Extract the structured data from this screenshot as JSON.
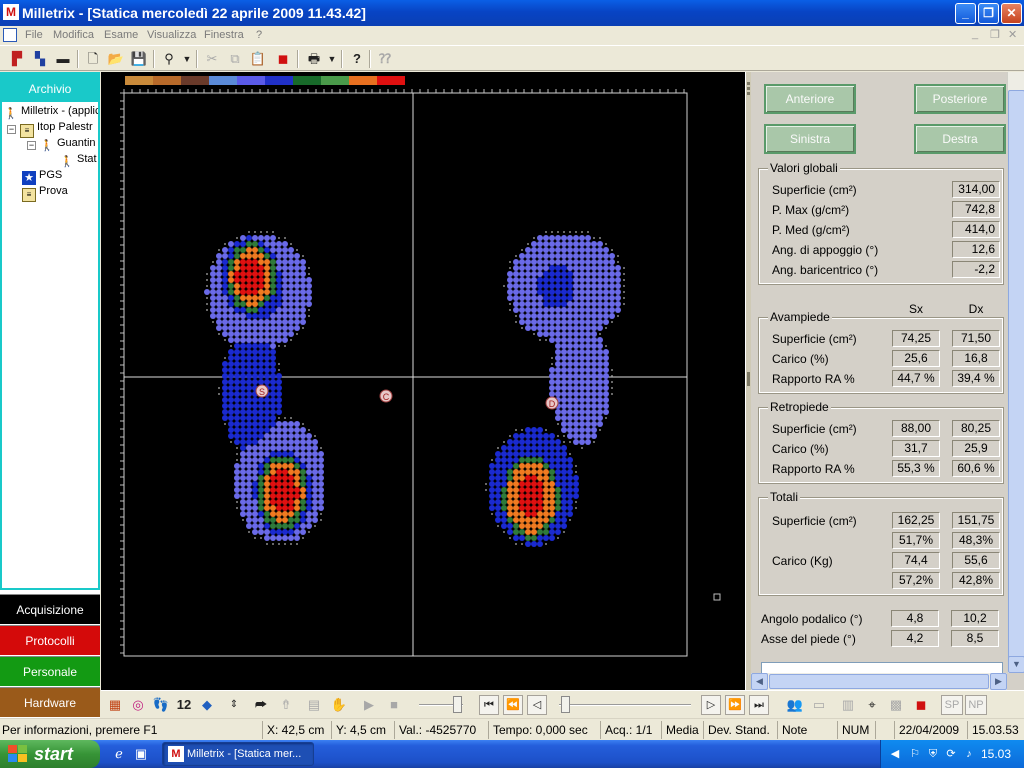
{
  "window": {
    "title": "Milletrix - [Statica mercoledì 22 aprile 2009 11.43.42]",
    "app_icon": "milletrix-logo"
  },
  "menu": {
    "items": [
      "File",
      "Modifica",
      "Esame",
      "Visualizza",
      "Finestra",
      "?"
    ]
  },
  "toolbar": {
    "icons": [
      "layout-icon",
      "split-layout-icon",
      "black-rect-icon",
      "new-file-icon",
      "open-folder-icon",
      "save-icon",
      "tools-icon",
      "cut-icon",
      "copy-icon",
      "paste-icon",
      "color-select-icon",
      "print-icon",
      "help-icon",
      "context-help-icon"
    ]
  },
  "left_panel": {
    "header": "Archivio",
    "tree": [
      {
        "label": "Milletrix - (applic",
        "icon": "person-icon"
      },
      {
        "label": "Itop Palestr",
        "icon": "folder-icon"
      },
      {
        "label": "Guantin",
        "icon": "person-icon"
      },
      {
        "label": "Stat",
        "icon": "person-icon"
      },
      {
        "label": "PGS",
        "icon": "pgs-icon"
      },
      {
        "label": "Prova",
        "icon": "folder-icon"
      }
    ],
    "nav": [
      {
        "label": "Acquisizione",
        "color": "#000000"
      },
      {
        "label": "Protocolli",
        "color": "#d40a0a"
      },
      {
        "label": "Personale",
        "color": "#139a13"
      },
      {
        "label": "Hardware",
        "color": "#9a5a1a"
      }
    ]
  },
  "canvas": {
    "colorbar": [
      "#c98a3a",
      "#b86a2a",
      "#6a3a2a",
      "#5a8ad8",
      "#5a5ae8",
      "#2030c8",
      "#186a2a",
      "#4a9a4a",
      "#e87020",
      "#e01010"
    ],
    "markers": {
      "s_label": "S",
      "c_label": "C",
      "d_label": "D"
    }
  },
  "right_panel": {
    "buttons": {
      "anteriore": "Anteriore",
      "posteriore": "Posteriore",
      "sinistra": "Sinistra",
      "destra": "Destra"
    },
    "valori_globali": {
      "title": "Valori globali",
      "rows": [
        {
          "label": "Superficie (cm²)",
          "value": "314,00"
        },
        {
          "label": "P. Max (g/cm²)",
          "value": "742,8"
        },
        {
          "label": "P. Med (g/cm²)",
          "value": "414,0"
        },
        {
          "label": "Ang. di appoggio (°)",
          "value": "12,6"
        },
        {
          "label": "Ang. baricentrico (°)",
          "value": "-2,2"
        }
      ]
    },
    "col_sx": "Sx",
    "col_dx": "Dx",
    "avampiede": {
      "title": "Avampiede",
      "rows": [
        {
          "label": "Superficie (cm²)",
          "sx": "74,25",
          "dx": "71,50"
        },
        {
          "label": "Carico (%)",
          "sx": "25,6",
          "dx": "16,8"
        },
        {
          "label": "Rapporto RA %",
          "sx": "44,7 %",
          "dx": "39,4 %"
        }
      ]
    },
    "retropiede": {
      "title": "Retropiede",
      "rows": [
        {
          "label": "Superficie (cm²)",
          "sx": "88,00",
          "dx": "80,25"
        },
        {
          "label": "Carico (%)",
          "sx": "31,7",
          "dx": "25,9"
        },
        {
          "label": "Rapporto RA %",
          "sx": "55,3 %",
          "dx": "60,6 %"
        }
      ]
    },
    "totali": {
      "title": "Totali",
      "superficie_label": "Superficie (cm²)",
      "superficie_sx": "162,25",
      "superficie_dx": "151,75",
      "superficie_pct_sx": "51,7%",
      "superficie_pct_dx": "48,3%",
      "carico_label": "Carico (Kg)",
      "carico_sx": "74,4",
      "carico_dx": "55,6",
      "carico_pct_sx": "57,2%",
      "carico_pct_dx": "42,8%"
    },
    "angolo_podalico": {
      "label": "Angolo podalico (°)",
      "sx": "4,8",
      "dx": "10,2"
    },
    "asse_piede": {
      "label": "Asse del piede (°)",
      "sx": "4,2",
      "dx": "8,5"
    }
  },
  "control_bar": {
    "count_label": "12",
    "buttons": {
      "sp": "SP",
      "np": "NP"
    }
  },
  "status": {
    "help": "Per informazioni, premere F1",
    "x": "X: 42,5 cm",
    "y": "Y: 4,5 cm",
    "val": "Val.: -4525770",
    "tempo": "Tempo: 0,000 sec",
    "acq": "Acq.: 1/1",
    "media": "Media",
    "dev": "Dev. Stand.",
    "note": "Note",
    "num": "NUM",
    "date": "22/04/2009",
    "time": "15.03.53"
  },
  "taskbar": {
    "start": "start",
    "task": "Milletrix - [Statica mer...",
    "clock": "15.03"
  }
}
